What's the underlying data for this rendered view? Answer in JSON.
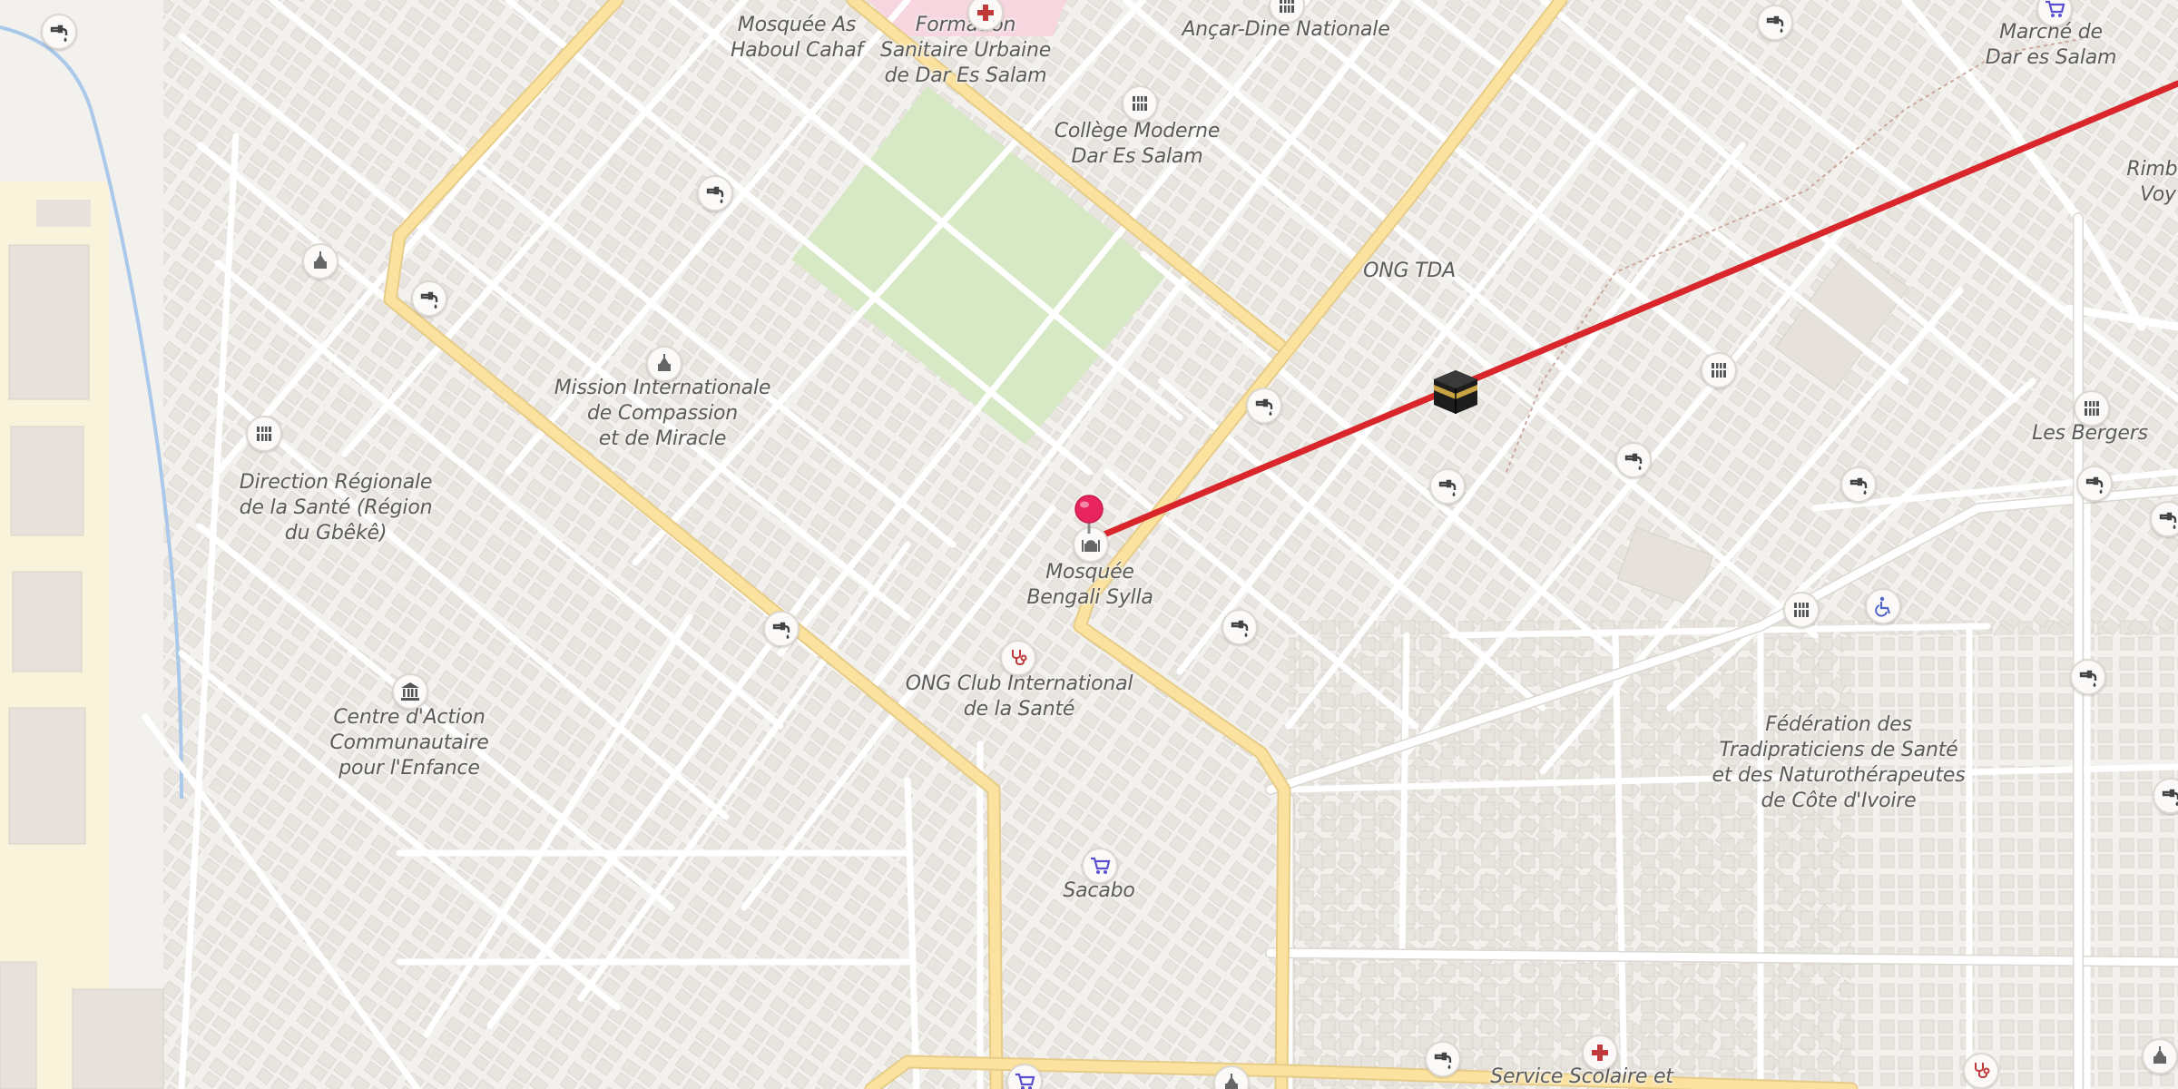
{
  "map": {
    "labels": [
      {
        "id": "mosquee-as-haboul-cahaf",
        "text": "Mosquée As\nHaboul Cahaf"
      },
      {
        "id": "formation-sanitaire",
        "text": "Formation\nSanitaire Urbaine\nde Dar Es Salam"
      },
      {
        "id": "ancar-dine-nationale",
        "text": "Ançar-Dine Nationale"
      },
      {
        "id": "marche-dar-es-salam",
        "text": "Marché de\nDar es Salam"
      },
      {
        "id": "rimbo",
        "text": "Rimbo\nVoy"
      },
      {
        "id": "college-moderne",
        "text": "Collège Moderne\nDar Es Salam"
      },
      {
        "id": "ong-tda",
        "text": "ONG TDA"
      },
      {
        "id": "les-bergers",
        "text": "Les Bergers"
      },
      {
        "id": "mission-internationale",
        "text": "Mission Internationale\nde Compassion\net de Miracle"
      },
      {
        "id": "direction-regionale",
        "text": "Direction Régionale\nde la Santé (Région\ndu Gbêkê)"
      },
      {
        "id": "mosquee-bengali-sylla",
        "text": "Mosquée\nBengali Sylla"
      },
      {
        "id": "ong-club-international",
        "text": "ONG Club International\nde la Santé"
      },
      {
        "id": "centre-action-communautaire",
        "text": "Centre d'Action\nCommunautaire\npour l'Enfance"
      },
      {
        "id": "federation-tradipraticiens",
        "text": "Fédération des\nTradipraticiens de Santé\net des Naturothérapeutes\nde Côte d'Ivoire"
      },
      {
        "id": "sacabo",
        "text": "Sacabo"
      },
      {
        "id": "service-scolaire",
        "text": "Service Scolaire et"
      }
    ],
    "pois": [
      {
        "icon": "water-tap-icon"
      },
      {
        "icon": "water-tap-icon"
      },
      {
        "icon": "water-tap-icon"
      },
      {
        "icon": "water-tap-icon"
      },
      {
        "icon": "water-tap-icon"
      },
      {
        "icon": "water-tap-icon"
      },
      {
        "icon": "water-tap-icon"
      },
      {
        "icon": "water-tap-icon"
      },
      {
        "icon": "water-tap-icon"
      },
      {
        "icon": "water-tap-icon"
      },
      {
        "icon": "water-tap-icon"
      },
      {
        "icon": "water-tap-icon"
      },
      {
        "icon": "water-tap-icon"
      },
      {
        "icon": "water-tap-icon"
      },
      {
        "icon": "water-tap-icon"
      },
      {
        "icon": "place-of-worship-icon"
      },
      {
        "icon": "place-of-worship-icon"
      },
      {
        "icon": "place-of-worship-icon"
      },
      {
        "icon": "place-of-worship-icon"
      },
      {
        "icon": "mosque-icon"
      },
      {
        "icon": "school-icon"
      },
      {
        "icon": "school-icon"
      },
      {
        "icon": "school-icon"
      },
      {
        "icon": "school-icon"
      },
      {
        "icon": "school-icon"
      },
      {
        "icon": "school-icon"
      },
      {
        "icon": "stethoscope-icon"
      },
      {
        "icon": "stethoscope-icon"
      },
      {
        "icon": "townhall-icon"
      },
      {
        "icon": "shopping-cart-icon"
      },
      {
        "icon": "shopping-cart-icon"
      },
      {
        "icon": "hospital-icon"
      },
      {
        "icon": "hospital-icon"
      },
      {
        "icon": "wheelchair-icon"
      },
      {
        "icon": "shopping-cart-icon"
      }
    ],
    "route_color": "#d9262b",
    "pin_color": "#e8245f",
    "destination_icon": "kaaba-icon",
    "origin_icon": "location-pin-icon"
  }
}
